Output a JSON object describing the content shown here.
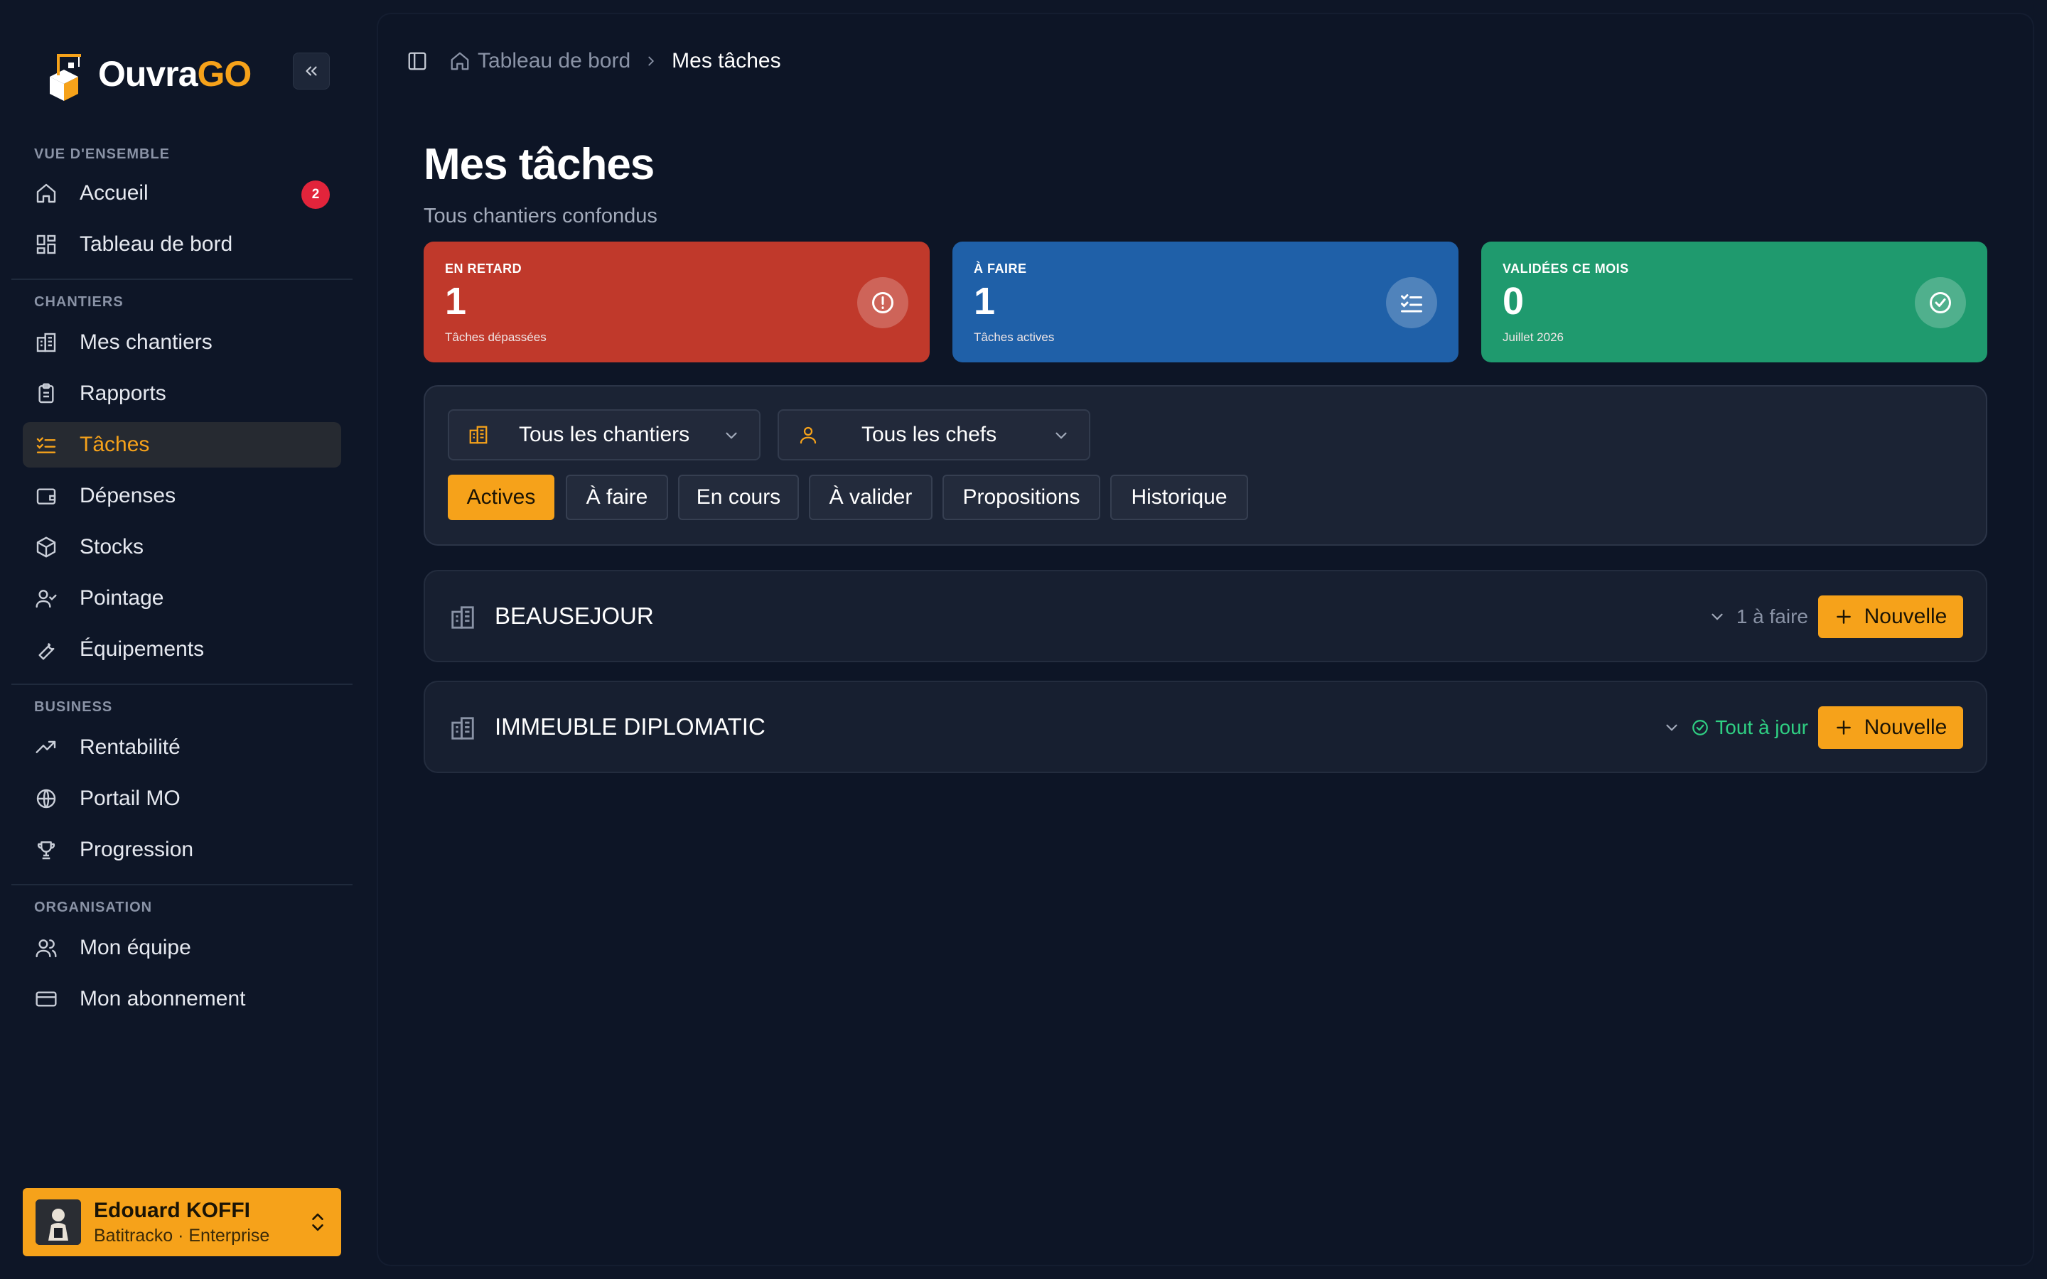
{
  "app": {
    "brand_prefix": "Ouvra",
    "brand_suffix": "GO"
  },
  "sidebar": {
    "sections": [
      {
        "label": "VUE D'ENSEMBLE"
      },
      {
        "label": "CHANTIERS"
      },
      {
        "label": "BUSINESS"
      },
      {
        "label": "ORGANISATION"
      }
    ],
    "items": [
      {
        "label": "Accueil",
        "icon": "home-icon",
        "badge": "2"
      },
      {
        "label": "Tableau de bord",
        "icon": "dashboard-icon"
      },
      {
        "label": "Mes chantiers",
        "icon": "building-icon"
      },
      {
        "label": "Rapports",
        "icon": "clipboard-icon"
      },
      {
        "label": "Tâches",
        "icon": "task-list-icon",
        "active": true
      },
      {
        "label": "Dépenses",
        "icon": "wallet-icon"
      },
      {
        "label": "Stocks",
        "icon": "package-icon"
      },
      {
        "label": "Pointage",
        "icon": "user-check-icon"
      },
      {
        "label": "Équipements",
        "icon": "wrench-icon"
      },
      {
        "label": "Rentabilité",
        "icon": "trending-up-icon"
      },
      {
        "label": "Portail MO",
        "icon": "globe-icon"
      },
      {
        "label": "Progression",
        "icon": "trophy-icon"
      },
      {
        "label": "Mon équipe",
        "icon": "users-icon"
      },
      {
        "label": "Mon abonnement",
        "icon": "credit-card-icon"
      }
    ],
    "user": {
      "name": "Edouard KOFFI",
      "subtitle": "Batitracko · Enterprise"
    }
  },
  "breadcrumb": {
    "home": "Tableau de bord",
    "current": "Mes tâches"
  },
  "page": {
    "title": "Mes tâches",
    "subtitle": "Tous chantiers confondus"
  },
  "stats": [
    {
      "label": "EN RETARD",
      "value": "1",
      "sub": "Tâches dépassées",
      "color": "#c0392b",
      "icon": "alert-circle-icon"
    },
    {
      "label": "À FAIRE",
      "value": "1",
      "sub": "Tâches actives",
      "color": "#1f60a8",
      "icon": "list-checks-icon"
    },
    {
      "label": "VALIDÉES CE MOIS",
      "value": "0",
      "sub": "Juillet 2026",
      "color": "#1f9a6e",
      "icon": "check-circle-icon"
    }
  ],
  "filters": {
    "chantier_select": "Tous les chantiers",
    "chef_select": "Tous les chefs",
    "tabs": [
      "Actives",
      "À faire",
      "En cours",
      "À valider",
      "Propositions",
      "Historique"
    ],
    "active_tab": "Actives"
  },
  "groups": [
    {
      "name": "BEAUSEJOUR",
      "status": "1 à faire",
      "button": "Nouvelle"
    },
    {
      "name": "IMMEUBLE DIPLOMATIC",
      "status": "Tout à jour",
      "button": "Nouvelle"
    }
  ],
  "colors": {
    "accent": "#f6a21a",
    "background": "#0e1627",
    "success": "#2fcf83",
    "badge": "#e2243b"
  }
}
